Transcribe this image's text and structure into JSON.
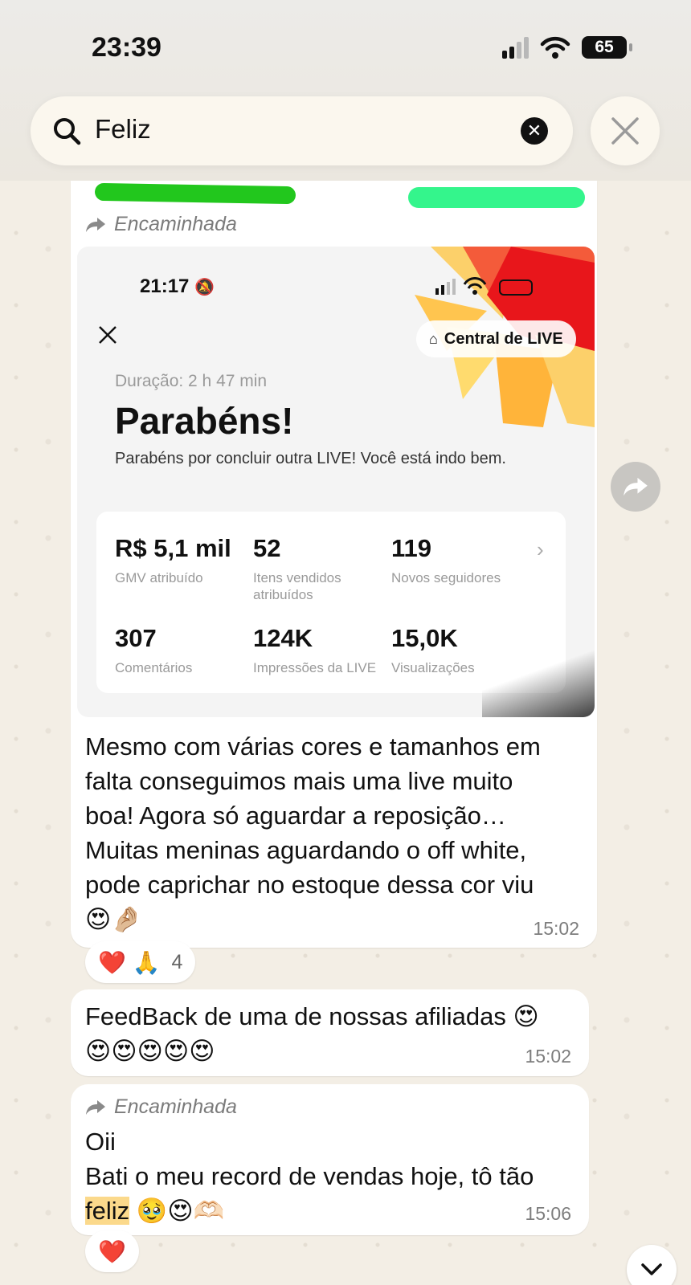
{
  "status_bar": {
    "time": "23:39",
    "battery": "65"
  },
  "search": {
    "query": "Feliz"
  },
  "messages": [
    {
      "forwarded_label": "Encaminhada",
      "screenshot": {
        "time": "21:17",
        "live_button": "Central de LIVE",
        "duration": "Duração: 2 h 47 min",
        "title": "Parabéns!",
        "subtitle": "Parabéns por concluir outra LIVE! Você está indo bem.",
        "stats": [
          {
            "value": "R$ 5,1 mil",
            "label": "GMV atribuído"
          },
          {
            "value": "52",
            "label": "Itens vendidos atribuídos"
          },
          {
            "value": "119",
            "label": "Novos seguidores"
          },
          {
            "value": "307",
            "label": "Comentários"
          },
          {
            "value": "124K",
            "label": "Impressões da LIVE"
          },
          {
            "value": "15,0K",
            "label": "Visualizações"
          }
        ]
      },
      "text_lines": [
        "Mesmo com várias cores e tamanhos em",
        "falta conseguimos mais uma live muito",
        "boa! Agora só aguardar a reposição…",
        "Muitas meninas aguardando o off white,",
        "pode caprichar no estoque dessa cor viu"
      ],
      "emojis": "😍🤌🏼",
      "time": "15:02",
      "reactions": {
        "emojis": "❤️ 🙏",
        "count": "4"
      }
    },
    {
      "text": "FeedBack de uma de nossas afiliadas 😍",
      "emojis": "😍😍😍😍😍",
      "time": "15:02"
    },
    {
      "forwarded_label": "Encaminhada",
      "line1": "Oii",
      "line2": "Bati o meu record de vendas hoje, tô tão",
      "highlight_word": "feliz",
      "trailing_emojis": "🥹😍🫶🏻",
      "time": "15:06",
      "reactions": {
        "emojis": "❤️"
      }
    }
  ],
  "colors": {
    "chat_background": "#f3eee5",
    "bubble": "#ffffff",
    "highlight": "#fbd98b"
  }
}
